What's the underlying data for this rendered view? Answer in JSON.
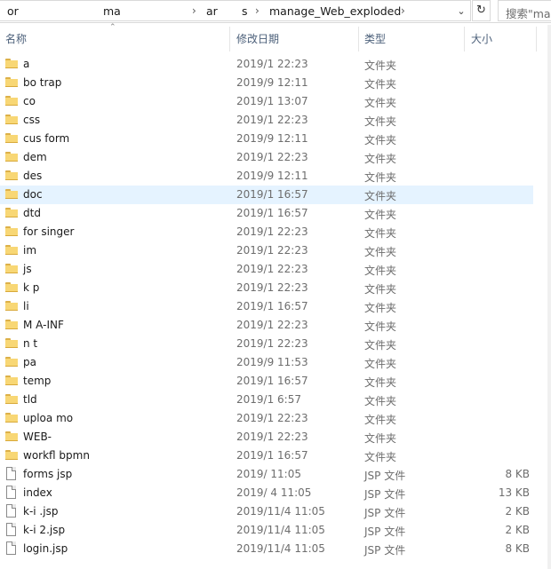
{
  "address": {
    "crumbs": [
      "or",
      "ma",
      "ar",
      "s",
      "manage_Web_exploded"
    ],
    "dropdown_icon": "chevron-down-icon",
    "refresh_icon": "refresh-icon",
    "search_placeholder": "搜索\"mar"
  },
  "columns": {
    "name": "名称",
    "date": "修改日期",
    "type": "类型",
    "size": "大小"
  },
  "rows": [
    {
      "name": "a",
      "date": "2019/1 22:23",
      "type": "文件夹",
      "size": "",
      "kind": "folder"
    },
    {
      "name": "bo trap",
      "date": "2019/9 12:11",
      "type": "文件夹",
      "size": "",
      "kind": "folder"
    },
    {
      "name": "co",
      "date": "2019/1 13:07",
      "type": "文件夹",
      "size": "",
      "kind": "folder"
    },
    {
      "name": "css",
      "date": "2019/1 22:23",
      "type": "文件夹",
      "size": "",
      "kind": "folder"
    },
    {
      "name": "cus form",
      "date": "2019/9 12:11",
      "type": "文件夹",
      "size": "",
      "kind": "folder"
    },
    {
      "name": "dem",
      "date": "2019/1 22:23",
      "type": "文件夹",
      "size": "",
      "kind": "folder"
    },
    {
      "name": "des",
      "date": "2019/9 12:11",
      "type": "文件夹",
      "size": "",
      "kind": "folder"
    },
    {
      "name": "doc",
      "date": "2019/1 16:57",
      "type": "文件夹",
      "size": "",
      "kind": "folder",
      "selected": true
    },
    {
      "name": "dtd",
      "date": "2019/1 16:57",
      "type": "文件夹",
      "size": "",
      "kind": "folder"
    },
    {
      "name": "for singer",
      "date": "2019/1 22:23",
      "type": "文件夹",
      "size": "",
      "kind": "folder"
    },
    {
      "name": "im",
      "date": "2019/1 22:23",
      "type": "文件夹",
      "size": "",
      "kind": "folder"
    },
    {
      "name": "js",
      "date": "2019/1 22:23",
      "type": "文件夹",
      "size": "",
      "kind": "folder"
    },
    {
      "name": "k p",
      "date": "2019/1 22:23",
      "type": "文件夹",
      "size": "",
      "kind": "folder"
    },
    {
      "name": "li",
      "date": "2019/1 16:57",
      "type": "文件夹",
      "size": "",
      "kind": "folder"
    },
    {
      "name": "M A-INF",
      "date": "2019/1 22:23",
      "type": "文件夹",
      "size": "",
      "kind": "folder"
    },
    {
      "name": "n t",
      "date": "2019/1 22:23",
      "type": "文件夹",
      "size": "",
      "kind": "folder"
    },
    {
      "name": "pa",
      "date": "2019/9 11:53",
      "type": "文件夹",
      "size": "",
      "kind": "folder"
    },
    {
      "name": "temp",
      "date": "2019/1 16:57",
      "type": "文件夹",
      "size": "",
      "kind": "folder"
    },
    {
      "name": "tld",
      "date": "2019/1 6:57",
      "type": "文件夹",
      "size": "",
      "kind": "folder"
    },
    {
      "name": "uploa mo",
      "date": "2019/1 22:23",
      "type": "文件夹",
      "size": "",
      "kind": "folder"
    },
    {
      "name": "WEB-",
      "date": "2019/1 22:23",
      "type": "文件夹",
      "size": "",
      "kind": "folder"
    },
    {
      "name": "workfl bpmn",
      "date": "2019/1 16:57",
      "type": "文件夹",
      "size": "",
      "kind": "folder"
    },
    {
      "name": "forms jsp",
      "date": "2019/ 11:05",
      "type": "JSP 文件",
      "size": "8 KB",
      "kind": "file"
    },
    {
      "name": "index",
      "date": "2019/ 4 11:05",
      "type": "JSP 文件",
      "size": "13 KB",
      "kind": "file"
    },
    {
      "name": "k-i .jsp",
      "date": "2019/11/4 11:05",
      "type": "JSP 文件",
      "size": "2 KB",
      "kind": "file"
    },
    {
      "name": "k-i 2.jsp",
      "date": "2019/11/4 11:05",
      "type": "JSP 文件",
      "size": "2 KB",
      "kind": "file"
    },
    {
      "name": "login.jsp",
      "date": "2019/11/4 11:05",
      "type": "JSP 文件",
      "size": "8 KB",
      "kind": "file"
    }
  ]
}
